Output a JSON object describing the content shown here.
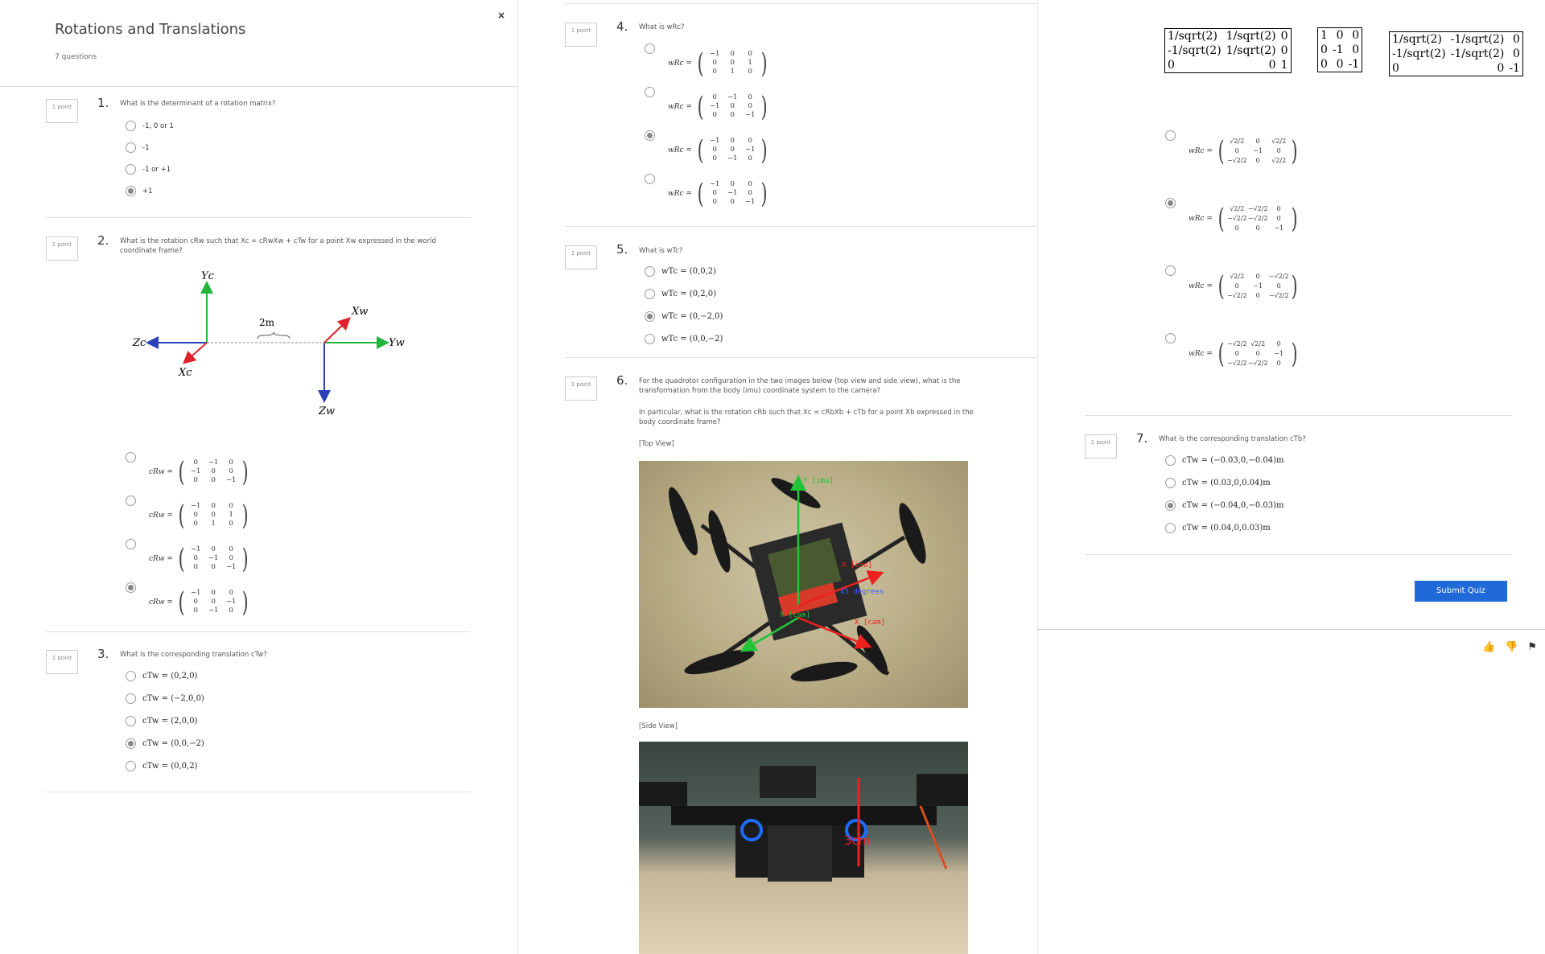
{
  "quiz": {
    "title": "Rotations and Translations",
    "count": "7 questions"
  },
  "point_label": "1 point",
  "q1": {
    "num": "1.",
    "text": "What is the determinant of a rotation matrix?",
    "options": [
      "-1, 0 or 1",
      "-1",
      "-1 or +1",
      "+1"
    ],
    "selected": 3
  },
  "q2": {
    "num": "2.",
    "text": "What is the rotation cRw such that Xc = cRwXw + cTw for a point Xw expressed in the world coordinate frame?",
    "diagram": {
      "yc": "Yc",
      "zc": "Zc",
      "xc": "Xc",
      "xw": "Xw",
      "yw": "Yw",
      "zw": "Zw",
      "dist": "2m"
    },
    "lhs": "cRw =",
    "matrices": [
      [
        [
          "0",
          "−1",
          "0"
        ],
        [
          "−1",
          "0",
          "0"
        ],
        [
          "0",
          "0",
          "−1"
        ]
      ],
      [
        [
          "−1",
          "0",
          "0"
        ],
        [
          "0",
          "0",
          "1"
        ],
        [
          "0",
          "1",
          "0"
        ]
      ],
      [
        [
          "−1",
          "0",
          "0"
        ],
        [
          "0",
          "−1",
          "0"
        ],
        [
          "0",
          "0",
          "−1"
        ]
      ],
      [
        [
          "−1",
          "0",
          "0"
        ],
        [
          "0",
          "0",
          "−1"
        ],
        [
          "0",
          "−1",
          "0"
        ]
      ]
    ],
    "selected": 3
  },
  "q3": {
    "num": "3.",
    "text": "What is the corresponding translation cTw?",
    "options": [
      "cTw = (0,2,0)",
      "cTw = (−2,0,0)",
      "cTw = (2,0,0)",
      "cTw = (0,0,−2)",
      "cTw = (0,0,2)"
    ],
    "selected": 3
  },
  "q4": {
    "num": "4.",
    "text": "What is wRc?",
    "lhs": "wRc =",
    "matrices": [
      [
        [
          "−1",
          "0",
          "0"
        ],
        [
          "0",
          "0",
          "1"
        ],
        [
          "0",
          "1",
          "0"
        ]
      ],
      [
        [
          "0",
          "−1",
          "0"
        ],
        [
          "−1",
          "0",
          "0"
        ],
        [
          "0",
          "0",
          "−1"
        ]
      ],
      [
        [
          "−1",
          "0",
          "0"
        ],
        [
          "0",
          "0",
          "−1"
        ],
        [
          "0",
          "−1",
          "0"
        ]
      ],
      [
        [
          "−1",
          "0",
          "0"
        ],
        [
          "0",
          "−1",
          "0"
        ],
        [
          "0",
          "0",
          "−1"
        ]
      ]
    ],
    "selected": 2
  },
  "q5": {
    "num": "5.",
    "text": "What is wTc?",
    "options": [
      "wTc = (0,0,2)",
      "wTc = (0,2,0)",
      "wTc = (0,−2,0)",
      "wTc = (0,0,−2)"
    ],
    "selected": 2
  },
  "q6": {
    "num": "6.",
    "text": "For the quadrotor configuration in the two images below (top view and side view), what is the transformation from the body (imu) coordinate system to the camera?",
    "text2": "In particular, what is the rotation cRb such that Xc = cRbXb + cTb for a point Xb expressed in the body coordinate frame?",
    "top_label": "[Top View]",
    "side_label": "[Side View]",
    "photo_labels": {
      "yimu": "Y [imu]",
      "ximu": "X [imu]",
      "deg": "45 degrees",
      "ycam": "Y [cam]",
      "xcam": "X [cam]",
      "dist": "3cm"
    },
    "lhs": "wRc =",
    "matrices": [
      [
        [
          "√2/2",
          "0",
          "√2/2"
        ],
        [
          "0",
          "−1",
          "0"
        ],
        [
          "−√2/2",
          "0",
          "√2/2"
        ]
      ],
      [
        [
          "√2/2",
          "−√2/2",
          "0"
        ],
        [
          "−√2/2",
          "−√2/2",
          "0"
        ],
        [
          "0",
          "0",
          "−1"
        ]
      ],
      [
        [
          "√2/2",
          "0",
          "−√2/2"
        ],
        [
          "0",
          "−1",
          "0"
        ],
        [
          "−√2/2",
          "0",
          "−√2/2"
        ]
      ],
      [
        [
          "−√2/2",
          "√2/2",
          "0"
        ],
        [
          "0",
          "0",
          "−1"
        ],
        [
          "−√2/2",
          "−√2/2",
          "0"
        ]
      ]
    ],
    "selected": 1
  },
  "boxes": [
    [
      [
        "1/sqrt(2)",
        "1/sqrt(2)",
        "0"
      ],
      [
        "-1/sqrt(2)",
        "1/sqrt(2)",
        "0"
      ],
      [
        "0",
        "0",
        "1"
      ]
    ],
    [
      [
        "1",
        "0",
        "0"
      ],
      [
        "0",
        "-1",
        "0"
      ],
      [
        "0",
        "0",
        "-1"
      ]
    ],
    [
      [
        "1/sqrt(2)",
        "-1/sqrt(2)",
        "0"
      ],
      [
        "-1/sqrt(2)",
        "-1/sqrt(2)",
        "0"
      ],
      [
        "0",
        "0",
        "-1"
      ]
    ]
  ],
  "q7": {
    "num": "7.",
    "text": "What is the corresponding translation cTb?",
    "options": [
      "cTw = (−0.03,0,−0.04)m",
      "cTw = (0.03,0,0.04)m",
      "cTw = (−0.04,0,−0.03)m",
      "cTw = (0.04,0,0.03)m"
    ],
    "selected": 2
  },
  "submit": "Submit Quiz",
  "close": "×",
  "colors": {
    "accent": "#1f6ad8",
    "axis_red": "#e0202a",
    "axis_green": "#22b53b",
    "axis_blue": "#2b3fb8"
  }
}
